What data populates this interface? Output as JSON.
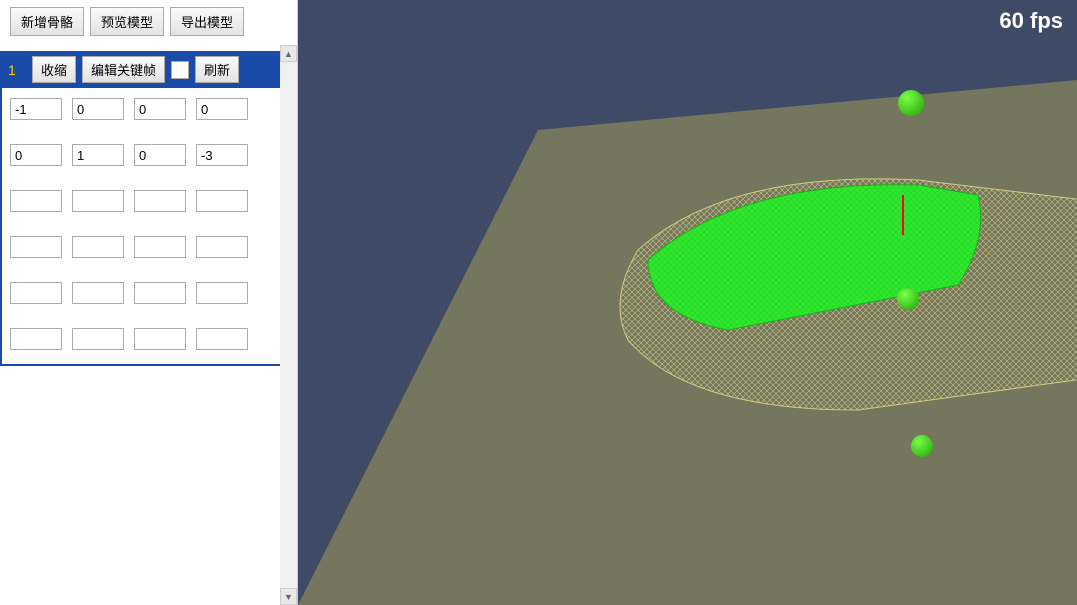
{
  "toolbar": {
    "addBone": "新增骨骼",
    "previewModel": "预览模型",
    "exportModel": "导出模型"
  },
  "bonePanel": {
    "index": "1",
    "collapse": "收缩",
    "editKeyframe": "编辑关键帧",
    "refresh": "刷新",
    "rows": [
      [
        "-1",
        "0",
        "0",
        "0"
      ],
      [
        "0",
        "1",
        "0",
        "-3"
      ],
      [
        "",
        "",
        "",
        ""
      ],
      [
        "",
        "",
        "",
        ""
      ],
      [
        "",
        "",
        "",
        ""
      ],
      [
        "",
        "",
        "",
        ""
      ]
    ]
  },
  "viewport": {
    "fps": "60 fps",
    "colors": {
      "background": "#3e4a66",
      "floor": "#989150",
      "wireframe": "#e0d98f",
      "highlight": "#2ee82e",
      "sphere": "#2ee82e",
      "axis": "#ff0000"
    },
    "iconNames": {
      "sphere1": "bone-joint-sphere",
      "sphere2": "bone-joint-sphere",
      "sphere3": "bone-joint-sphere"
    }
  }
}
